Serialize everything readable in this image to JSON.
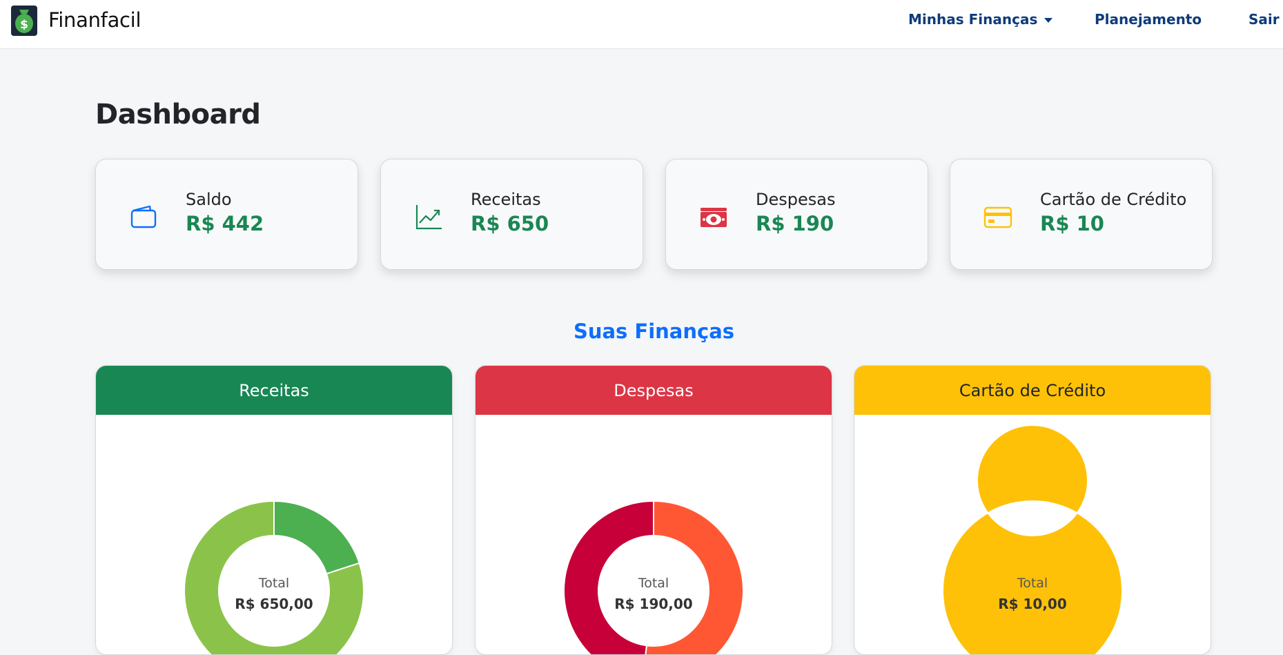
{
  "app": {
    "name": "Finanfacil"
  },
  "nav": {
    "items": [
      {
        "label": "Minhas Finanças",
        "dropdown": true
      },
      {
        "label": "Planejamento",
        "dropdown": false
      },
      {
        "label": "Sair",
        "dropdown": false
      }
    ]
  },
  "page": {
    "title": "Dashboard"
  },
  "stats": [
    {
      "label": "Saldo",
      "value": "R$ 442",
      "icon": "wallet-icon",
      "color": "#0d6efd"
    },
    {
      "label": "Receitas",
      "value": "R$ 650",
      "icon": "graph-up-icon",
      "color": "#198754"
    },
    {
      "label": "Despesas",
      "value": "R$ 190",
      "icon": "cash-icon",
      "color": "#dc3545"
    },
    {
      "label": "Cartão de Crédito",
      "value": "R$ 10",
      "icon": "credit-card-icon",
      "color": "#ffc107"
    }
  ],
  "section": {
    "title": "Suas Finanças"
  },
  "charts": [
    {
      "title": "Receitas",
      "header_color": "#198754",
      "header_text_color": "#ffffff",
      "total_label": "Total",
      "total_value": "R$ 650,00"
    },
    {
      "title": "Despesas",
      "header_color": "#dc3545",
      "header_text_color": "#ffffff",
      "total_label": "Total",
      "total_value": "R$ 190,00"
    },
    {
      "title": "Cartão de Crédito",
      "header_color": "#ffc107",
      "header_text_color": "#212529",
      "total_label": "Total",
      "total_value": "R$ 10,00"
    }
  ],
  "chart_data": [
    {
      "type": "pie",
      "donut": true,
      "slices": [
        {
          "value": 0.2,
          "color": "#4caf50"
        },
        {
          "value": 0.8,
          "color": "#8bc34a"
        }
      ]
    },
    {
      "type": "pie",
      "donut": true,
      "slices": [
        {
          "value": 0.52,
          "color": "#ff5733"
        },
        {
          "value": 0.48,
          "color": "#c70039"
        }
      ]
    },
    {
      "type": "pie",
      "donut": true,
      "slices": [
        {
          "value": 1.0,
          "color": "#ffc107"
        }
      ]
    }
  ]
}
